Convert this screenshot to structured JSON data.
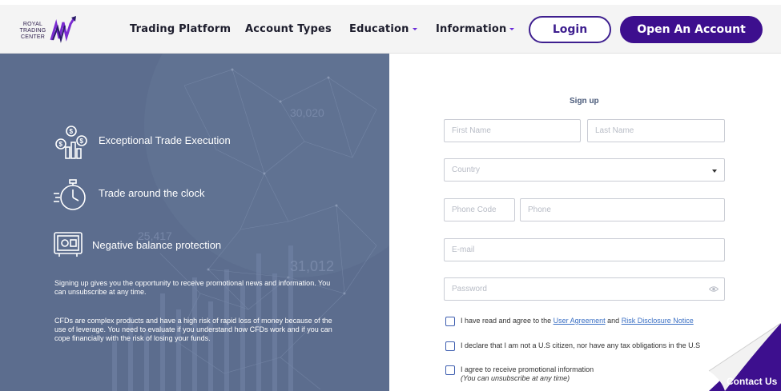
{
  "brand": {
    "logo_text": "ROYAL TRADING CENTER"
  },
  "nav": {
    "items": [
      {
        "label": "Trading Platform",
        "dropdown": false
      },
      {
        "label": "Account Types",
        "dropdown": false
      },
      {
        "label": "Education",
        "dropdown": true
      },
      {
        "label": "Information",
        "dropdown": true
      }
    ],
    "login_label": "Login",
    "open_account_label": "Open An Account"
  },
  "left": {
    "features": [
      {
        "label": "Exceptional Trade Execution",
        "icon": "money-bars-icon"
      },
      {
        "label": "Trade around the clock",
        "icon": "stopwatch-icon"
      },
      {
        "label": "Negative balance protection",
        "icon": "safe-icon"
      }
    ],
    "bg_numbers": [
      "30,020",
      "25,417",
      "31,012"
    ],
    "promo_text": "Signing up gives you the opportunity to receive promotional news and information. You can unsubscribe at any time.",
    "risk_text": "CFDs are complex products and have a high risk of rapid loss of money because of the use of leverage. You need to evaluate if you understand how CFDs work and if you can cope financially with the risk of losing your funds."
  },
  "form": {
    "title": "Sign up",
    "first_name_placeholder": "First Name",
    "last_name_placeholder": "Last Name",
    "country_placeholder": "Country",
    "phone_code_placeholder": "Phone Code",
    "phone_placeholder": "Phone",
    "email_placeholder": "E-mail",
    "password_placeholder": "Password",
    "agree": {
      "prefix": "I have read and agree to the",
      "link1": "User Agreement",
      "middle": "and",
      "link2": "Risk Disclosure Notice"
    },
    "us_declare": "I declare that I am not a U.S citizen, nor have any tax obligations in the U.S",
    "promo_agree": "I agree to receive promotional information",
    "promo_note": "(You can unsubscribe at any time)"
  },
  "contact_label": "Contact Us",
  "colors": {
    "primary": "#3d0f8e",
    "left_panel": "#5c6d8e",
    "link": "#3a6fc4"
  }
}
